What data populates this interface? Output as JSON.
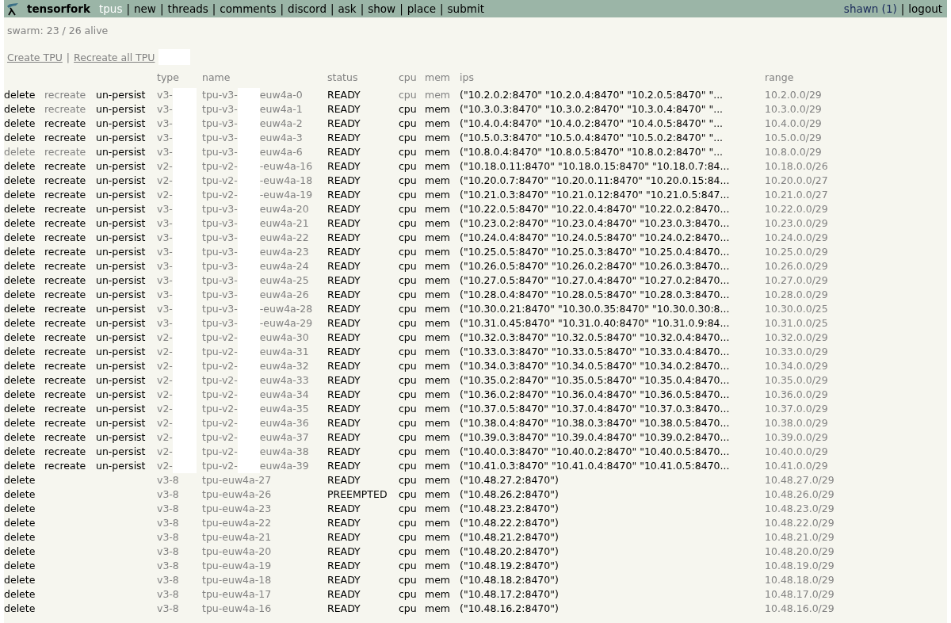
{
  "nav": {
    "brand": "tensorfork",
    "separator": "|",
    "items": [
      {
        "label": "tpus",
        "selected": true
      },
      {
        "label": "new",
        "selected": false
      },
      {
        "label": "threads",
        "selected": false
      },
      {
        "label": "comments",
        "selected": false
      },
      {
        "label": "discord",
        "selected": false
      },
      {
        "label": "ask",
        "selected": false
      },
      {
        "label": "show",
        "selected": false
      },
      {
        "label": "place",
        "selected": false
      },
      {
        "label": "submit",
        "selected": false
      }
    ],
    "user": "shawn (1)",
    "logout": "logout"
  },
  "swarm": "swarm: 23 / 26 alive",
  "links": {
    "separator": "|",
    "items": [
      {
        "label": "Create TPU",
        "redacted": false
      },
      {
        "label": "Recreate all TPU",
        "redacted": true
      }
    ]
  },
  "table": {
    "columns": [
      "type",
      "name",
      "status",
      "cpu",
      "mem",
      "ips",
      "range"
    ],
    "rows": [
      {
        "actions": [
          {
            "label": "delete",
            "disabled": false
          },
          {
            "label": "recreate",
            "disabled": true
          },
          {
            "label": "un-persist",
            "disabled": false
          }
        ],
        "redacted": true,
        "type": "v3-",
        "name": "tpu-v3-",
        "name_tail": "euw4a-0",
        "status": "READY",
        "cpu": {
          "label": "cpu",
          "disabled": true
        },
        "mem": {
          "label": "mem",
          "disabled": true
        },
        "ips": "(\"10.2.0.2:8470\" \"10.2.0.4:8470\" \"10.2.0.5:8470\" \"...",
        "range": "10.2.0.0/29"
      },
      {
        "actions": [
          {
            "label": "delete",
            "disabled": false
          },
          {
            "label": "recreate",
            "disabled": true
          },
          {
            "label": "un-persist",
            "disabled": false
          }
        ],
        "redacted": true,
        "type": "v3-",
        "name": "tpu-v3-",
        "name_tail": "euw4a-1",
        "status": "READY",
        "cpu": {
          "label": "cpu",
          "disabled": false
        },
        "mem": {
          "label": "mem",
          "disabled": false
        },
        "ips": "(\"10.3.0.3:8470\" \"10.3.0.2:8470\" \"10.3.0.4:8470\" \"...",
        "range": "10.3.0.0/29"
      },
      {
        "actions": [
          {
            "label": "delete",
            "disabled": false
          },
          {
            "label": "recreate",
            "disabled": false
          },
          {
            "label": "un-persist",
            "disabled": false
          }
        ],
        "redacted": true,
        "type": "v3-",
        "name": "tpu-v3-",
        "name_tail": "euw4a-2",
        "status": "READY",
        "cpu": {
          "label": "cpu",
          "disabled": false
        },
        "mem": {
          "label": "mem",
          "disabled": false
        },
        "ips": "(\"10.4.0.4:8470\" \"10.4.0.2:8470\" \"10.4.0.5:8470\" \"...",
        "range": "10.4.0.0/29"
      },
      {
        "actions": [
          {
            "label": "delete",
            "disabled": false
          },
          {
            "label": "recreate",
            "disabled": false
          },
          {
            "label": "un-persist",
            "disabled": false
          }
        ],
        "redacted": true,
        "type": "v3-",
        "name": "tpu-v3-",
        "name_tail": "euw4a-3",
        "status": "READY",
        "cpu": {
          "label": "cpu",
          "disabled": false
        },
        "mem": {
          "label": "mem",
          "disabled": false
        },
        "ips": "(\"10.5.0.3:8470\" \"10.5.0.4:8470\" \"10.5.0.2:8470\" \"...",
        "range": "10.5.0.0/29"
      },
      {
        "actions": [
          {
            "label": "delete",
            "disabled": true
          },
          {
            "label": "recreate",
            "disabled": true
          },
          {
            "label": "un-persist",
            "disabled": false
          }
        ],
        "redacted": true,
        "type": "v3-",
        "name": "tpu-v3-",
        "name_tail": "euw4a-6",
        "status": "READY",
        "cpu": {
          "label": "cpu",
          "disabled": false
        },
        "mem": {
          "label": "mem",
          "disabled": false
        },
        "ips": "(\"10.8.0.4:8470\" \"10.8.0.5:8470\" \"10.8.0.2:8470\" \"...",
        "range": "10.8.0.0/29"
      },
      {
        "actions": [
          {
            "label": "delete",
            "disabled": false
          },
          {
            "label": "recreate",
            "disabled": false
          },
          {
            "label": "un-persist",
            "disabled": false
          }
        ],
        "redacted": true,
        "type": "v2-",
        "name": "tpu-v2-",
        "name_tail": "-euw4a-16",
        "status": "READY",
        "cpu": {
          "label": "cpu",
          "disabled": false
        },
        "mem": {
          "label": "mem",
          "disabled": false
        },
        "ips": "(\"10.18.0.11:8470\" \"10.18.0.15:8470\" \"10.18.0.7:84...",
        "range": "10.18.0.0/26"
      },
      {
        "actions": [
          {
            "label": "delete",
            "disabled": false
          },
          {
            "label": "recreate",
            "disabled": false
          },
          {
            "label": "un-persist",
            "disabled": false
          }
        ],
        "redacted": true,
        "type": "v2-",
        "name": "tpu-v2-",
        "name_tail": "-euw4a-18",
        "status": "READY",
        "cpu": {
          "label": "cpu",
          "disabled": false
        },
        "mem": {
          "label": "mem",
          "disabled": false
        },
        "ips": "(\"10.20.0.7:8470\" \"10.20.0.11:8470\" \"10.20.0.15:84...",
        "range": "10.20.0.0/27"
      },
      {
        "actions": [
          {
            "label": "delete",
            "disabled": false
          },
          {
            "label": "recreate",
            "disabled": false
          },
          {
            "label": "un-persist",
            "disabled": false
          }
        ],
        "redacted": true,
        "type": "v2-",
        "name": "tpu-v2-",
        "name_tail": "-euw4a-19",
        "status": "READY",
        "cpu": {
          "label": "cpu",
          "disabled": false
        },
        "mem": {
          "label": "mem",
          "disabled": false
        },
        "ips": "(\"10.21.0.3:8470\" \"10.21.0.12:8470\" \"10.21.0.5:847...",
        "range": "10.21.0.0/27"
      },
      {
        "actions": [
          {
            "label": "delete",
            "disabled": false
          },
          {
            "label": "recreate",
            "disabled": false
          },
          {
            "label": "un-persist",
            "disabled": false
          }
        ],
        "redacted": true,
        "type": "v3-",
        "name": "tpu-v3-",
        "name_tail": "euw4a-20",
        "status": "READY",
        "cpu": {
          "label": "cpu",
          "disabled": false
        },
        "mem": {
          "label": "mem",
          "disabled": false
        },
        "ips": "(\"10.22.0.5:8470\" \"10.22.0.4:8470\" \"10.22.0.2:8470...",
        "range": "10.22.0.0/29"
      },
      {
        "actions": [
          {
            "label": "delete",
            "disabled": false
          },
          {
            "label": "recreate",
            "disabled": false
          },
          {
            "label": "un-persist",
            "disabled": false
          }
        ],
        "redacted": true,
        "type": "v3-",
        "name": "tpu-v3-",
        "name_tail": "euw4a-21",
        "status": "READY",
        "cpu": {
          "label": "cpu",
          "disabled": false
        },
        "mem": {
          "label": "mem",
          "disabled": false
        },
        "ips": "(\"10.23.0.2:8470\" \"10.23.0.4:8470\" \"10.23.0.3:8470...",
        "range": "10.23.0.0/29"
      },
      {
        "actions": [
          {
            "label": "delete",
            "disabled": false
          },
          {
            "label": "recreate",
            "disabled": false
          },
          {
            "label": "un-persist",
            "disabled": false
          }
        ],
        "redacted": true,
        "type": "v3-",
        "name": "tpu-v3-",
        "name_tail": "euw4a-22",
        "status": "READY",
        "cpu": {
          "label": "cpu",
          "disabled": false
        },
        "mem": {
          "label": "mem",
          "disabled": false
        },
        "ips": "(\"10.24.0.4:8470\" \"10.24.0.5:8470\" \"10.24.0.2:8470...",
        "range": "10.24.0.0/29"
      },
      {
        "actions": [
          {
            "label": "delete",
            "disabled": false
          },
          {
            "label": "recreate",
            "disabled": false
          },
          {
            "label": "un-persist",
            "disabled": false
          }
        ],
        "redacted": true,
        "type": "v3-",
        "name": "tpu-v3-",
        "name_tail": "euw4a-23",
        "status": "READY",
        "cpu": {
          "label": "cpu",
          "disabled": false
        },
        "mem": {
          "label": "mem",
          "disabled": false
        },
        "ips": "(\"10.25.0.5:8470\" \"10.25.0.3:8470\" \"10.25.0.4:8470...",
        "range": "10.25.0.0/29"
      },
      {
        "actions": [
          {
            "label": "delete",
            "disabled": false
          },
          {
            "label": "recreate",
            "disabled": false
          },
          {
            "label": "un-persist",
            "disabled": false
          }
        ],
        "redacted": true,
        "type": "v3-",
        "name": "tpu-v3-",
        "name_tail": "euw4a-24",
        "status": "READY",
        "cpu": {
          "label": "cpu",
          "disabled": false
        },
        "mem": {
          "label": "mem",
          "disabled": false
        },
        "ips": "(\"10.26.0.5:8470\" \"10.26.0.2:8470\" \"10.26.0.3:8470...",
        "range": "10.26.0.0/29"
      },
      {
        "actions": [
          {
            "label": "delete",
            "disabled": false
          },
          {
            "label": "recreate",
            "disabled": false
          },
          {
            "label": "un-persist",
            "disabled": false
          }
        ],
        "redacted": true,
        "type": "v3-",
        "name": "tpu-v3-",
        "name_tail": "euw4a-25",
        "status": "READY",
        "cpu": {
          "label": "cpu",
          "disabled": false
        },
        "mem": {
          "label": "mem",
          "disabled": false
        },
        "ips": "(\"10.27.0.5:8470\" \"10.27.0.4:8470\" \"10.27.0.2:8470...",
        "range": "10.27.0.0/29"
      },
      {
        "actions": [
          {
            "label": "delete",
            "disabled": false
          },
          {
            "label": "recreate",
            "disabled": false
          },
          {
            "label": "un-persist",
            "disabled": false
          }
        ],
        "redacted": true,
        "type": "v3-",
        "name": "tpu-v3-",
        "name_tail": "euw4a-26",
        "status": "READY",
        "cpu": {
          "label": "cpu",
          "disabled": false
        },
        "mem": {
          "label": "mem",
          "disabled": false
        },
        "ips": "(\"10.28.0.4:8470\" \"10.28.0.5:8470\" \"10.28.0.3:8470...",
        "range": "10.28.0.0/29"
      },
      {
        "actions": [
          {
            "label": "delete",
            "disabled": false
          },
          {
            "label": "recreate",
            "disabled": false
          },
          {
            "label": "un-persist",
            "disabled": false
          }
        ],
        "redacted": true,
        "type": "v3-",
        "name": "tpu-v3-",
        "name_tail": "-euw4a-28",
        "status": "READY",
        "cpu": {
          "label": "cpu",
          "disabled": false
        },
        "mem": {
          "label": "mem",
          "disabled": false
        },
        "ips": "(\"10.30.0.21:8470\" \"10.30.0.35:8470\" \"10.30.0.30:8...",
        "range": "10.30.0.0/25"
      },
      {
        "actions": [
          {
            "label": "delete",
            "disabled": false
          },
          {
            "label": "recreate",
            "disabled": false
          },
          {
            "label": "un-persist",
            "disabled": false
          }
        ],
        "redacted": true,
        "type": "v3-",
        "name": "tpu-v3-",
        "name_tail": "-euw4a-29",
        "status": "READY",
        "cpu": {
          "label": "cpu",
          "disabled": false
        },
        "mem": {
          "label": "mem",
          "disabled": false
        },
        "ips": "(\"10.31.0.45:8470\" \"10.31.0.40:8470\" \"10.31.0.9:84...",
        "range": "10.31.0.0/25"
      },
      {
        "actions": [
          {
            "label": "delete",
            "disabled": false
          },
          {
            "label": "recreate",
            "disabled": false
          },
          {
            "label": "un-persist",
            "disabled": false
          }
        ],
        "redacted": true,
        "type": "v2-",
        "name": "tpu-v2-",
        "name_tail": "euw4a-30",
        "status": "READY",
        "cpu": {
          "label": "cpu",
          "disabled": false
        },
        "mem": {
          "label": "mem",
          "disabled": false
        },
        "ips": "(\"10.32.0.3:8470\" \"10.32.0.5:8470\" \"10.32.0.4:8470...",
        "range": "10.32.0.0/29"
      },
      {
        "actions": [
          {
            "label": "delete",
            "disabled": false
          },
          {
            "label": "recreate",
            "disabled": false
          },
          {
            "label": "un-persist",
            "disabled": false
          }
        ],
        "redacted": true,
        "type": "v2-",
        "name": "tpu-v2-",
        "name_tail": "euw4a-31",
        "status": "READY",
        "cpu": {
          "label": "cpu",
          "disabled": false
        },
        "mem": {
          "label": "mem",
          "disabled": false
        },
        "ips": "(\"10.33.0.3:8470\" \"10.33.0.5:8470\" \"10.33.0.4:8470...",
        "range": "10.33.0.0/29"
      },
      {
        "actions": [
          {
            "label": "delete",
            "disabled": false
          },
          {
            "label": "recreate",
            "disabled": false
          },
          {
            "label": "un-persist",
            "disabled": false
          }
        ],
        "redacted": true,
        "type": "v2-",
        "name": "tpu-v2-",
        "name_tail": "euw4a-32",
        "status": "READY",
        "cpu": {
          "label": "cpu",
          "disabled": false
        },
        "mem": {
          "label": "mem",
          "disabled": false
        },
        "ips": "(\"10.34.0.3:8470\" \"10.34.0.5:8470\" \"10.34.0.2:8470...",
        "range": "10.34.0.0/29"
      },
      {
        "actions": [
          {
            "label": "delete",
            "disabled": false
          },
          {
            "label": "recreate",
            "disabled": false
          },
          {
            "label": "un-persist",
            "disabled": false
          }
        ],
        "redacted": true,
        "type": "v2-",
        "name": "tpu-v2-",
        "name_tail": "euw4a-33",
        "status": "READY",
        "cpu": {
          "label": "cpu",
          "disabled": false
        },
        "mem": {
          "label": "mem",
          "disabled": false
        },
        "ips": "(\"10.35.0.2:8470\" \"10.35.0.5:8470\" \"10.35.0.4:8470...",
        "range": "10.35.0.0/29"
      },
      {
        "actions": [
          {
            "label": "delete",
            "disabled": false
          },
          {
            "label": "recreate",
            "disabled": false
          },
          {
            "label": "un-persist",
            "disabled": false
          }
        ],
        "redacted": true,
        "type": "v2-",
        "name": "tpu-v2-",
        "name_tail": "euw4a-34",
        "status": "READY",
        "cpu": {
          "label": "cpu",
          "disabled": false
        },
        "mem": {
          "label": "mem",
          "disabled": false
        },
        "ips": "(\"10.36.0.2:8470\" \"10.36.0.4:8470\" \"10.36.0.5:8470...",
        "range": "10.36.0.0/29"
      },
      {
        "actions": [
          {
            "label": "delete",
            "disabled": false
          },
          {
            "label": "recreate",
            "disabled": false
          },
          {
            "label": "un-persist",
            "disabled": false
          }
        ],
        "redacted": true,
        "type": "v2-",
        "name": "tpu-v2-",
        "name_tail": "euw4a-35",
        "status": "READY",
        "cpu": {
          "label": "cpu",
          "disabled": false
        },
        "mem": {
          "label": "mem",
          "disabled": false
        },
        "ips": "(\"10.37.0.5:8470\" \"10.37.0.4:8470\" \"10.37.0.3:8470...",
        "range": "10.37.0.0/29"
      },
      {
        "actions": [
          {
            "label": "delete",
            "disabled": false
          },
          {
            "label": "recreate",
            "disabled": false
          },
          {
            "label": "un-persist",
            "disabled": false
          }
        ],
        "redacted": true,
        "type": "v2-",
        "name": "tpu-v2-",
        "name_tail": "euw4a-36",
        "status": "READY",
        "cpu": {
          "label": "cpu",
          "disabled": false
        },
        "mem": {
          "label": "mem",
          "disabled": false
        },
        "ips": "(\"10.38.0.4:8470\" \"10.38.0.3:8470\" \"10.38.0.5:8470...",
        "range": "10.38.0.0/29"
      },
      {
        "actions": [
          {
            "label": "delete",
            "disabled": false
          },
          {
            "label": "recreate",
            "disabled": false
          },
          {
            "label": "un-persist",
            "disabled": false
          }
        ],
        "redacted": true,
        "type": "v2-",
        "name": "tpu-v2-",
        "name_tail": "euw4a-37",
        "status": "READY",
        "cpu": {
          "label": "cpu",
          "disabled": false
        },
        "mem": {
          "label": "mem",
          "disabled": false
        },
        "ips": "(\"10.39.0.3:8470\" \"10.39.0.4:8470\" \"10.39.0.2:8470...",
        "range": "10.39.0.0/29"
      },
      {
        "actions": [
          {
            "label": "delete",
            "disabled": false
          },
          {
            "label": "recreate",
            "disabled": false
          },
          {
            "label": "un-persist",
            "disabled": false
          }
        ],
        "redacted": true,
        "type": "v2-",
        "name": "tpu-v2-",
        "name_tail": "euw4a-38",
        "status": "READY",
        "cpu": {
          "label": "cpu",
          "disabled": false
        },
        "mem": {
          "label": "mem",
          "disabled": false
        },
        "ips": "(\"10.40.0.3:8470\" \"10.40.0.2:8470\" \"10.40.0.5:8470...",
        "range": "10.40.0.0/29"
      },
      {
        "actions": [
          {
            "label": "delete",
            "disabled": false
          },
          {
            "label": "recreate",
            "disabled": false
          },
          {
            "label": "un-persist",
            "disabled": false
          }
        ],
        "redacted": true,
        "type": "v2-",
        "name": "tpu-v2-",
        "name_tail": "euw4a-39",
        "status": "READY",
        "cpu": {
          "label": "cpu",
          "disabled": false
        },
        "mem": {
          "label": "mem",
          "disabled": false
        },
        "ips": "(\"10.41.0.3:8470\" \"10.41.0.4:8470\" \"10.41.0.5:8470...",
        "range": "10.41.0.0/29"
      },
      {
        "actions": [
          {
            "label": "delete",
            "disabled": false
          }
        ],
        "redacted": false,
        "type": "v3-8",
        "name": "tpu-euw4a-27",
        "status": "READY",
        "cpu": {
          "label": "cpu",
          "disabled": false
        },
        "mem": {
          "label": "mem",
          "disabled": false
        },
        "ips": "(\"10.48.27.2:8470\")",
        "range": "10.48.27.0/29"
      },
      {
        "actions": [
          {
            "label": "delete",
            "disabled": false
          }
        ],
        "redacted": false,
        "type": "v3-8",
        "name": "tpu-euw4a-26",
        "status": "PREEMPTED",
        "cpu": {
          "label": "cpu",
          "disabled": false
        },
        "mem": {
          "label": "mem",
          "disabled": false
        },
        "ips": "(\"10.48.26.2:8470\")",
        "range": "10.48.26.0/29"
      },
      {
        "actions": [
          {
            "label": "delete",
            "disabled": false
          }
        ],
        "redacted": false,
        "type": "v3-8",
        "name": "tpu-euw4a-23",
        "status": "READY",
        "cpu": {
          "label": "cpu",
          "disabled": false
        },
        "mem": {
          "label": "mem",
          "disabled": false
        },
        "ips": "(\"10.48.23.2:8470\")",
        "range": "10.48.23.0/29"
      },
      {
        "actions": [
          {
            "label": "delete",
            "disabled": false
          }
        ],
        "redacted": false,
        "type": "v3-8",
        "name": "tpu-euw4a-22",
        "status": "READY",
        "cpu": {
          "label": "cpu",
          "disabled": false
        },
        "mem": {
          "label": "mem",
          "disabled": false
        },
        "ips": "(\"10.48.22.2:8470\")",
        "range": "10.48.22.0/29"
      },
      {
        "actions": [
          {
            "label": "delete",
            "disabled": false
          }
        ],
        "redacted": false,
        "type": "v3-8",
        "name": "tpu-euw4a-21",
        "status": "READY",
        "cpu": {
          "label": "cpu",
          "disabled": false
        },
        "mem": {
          "label": "mem",
          "disabled": false
        },
        "ips": "(\"10.48.21.2:8470\")",
        "range": "10.48.21.0/29"
      },
      {
        "actions": [
          {
            "label": "delete",
            "disabled": false
          }
        ],
        "redacted": false,
        "type": "v3-8",
        "name": "tpu-euw4a-20",
        "status": "READY",
        "cpu": {
          "label": "cpu",
          "disabled": false
        },
        "mem": {
          "label": "mem",
          "disabled": false
        },
        "ips": "(\"10.48.20.2:8470\")",
        "range": "10.48.20.0/29"
      },
      {
        "actions": [
          {
            "label": "delete",
            "disabled": false
          }
        ],
        "redacted": false,
        "type": "v3-8",
        "name": "tpu-euw4a-19",
        "status": "READY",
        "cpu": {
          "label": "cpu",
          "disabled": false
        },
        "mem": {
          "label": "mem",
          "disabled": false
        },
        "ips": "(\"10.48.19.2:8470\")",
        "range": "10.48.19.0/29"
      },
      {
        "actions": [
          {
            "label": "delete",
            "disabled": false
          }
        ],
        "redacted": false,
        "type": "v3-8",
        "name": "tpu-euw4a-18",
        "status": "READY",
        "cpu": {
          "label": "cpu",
          "disabled": false
        },
        "mem": {
          "label": "mem",
          "disabled": false
        },
        "ips": "(\"10.48.18.2:8470\")",
        "range": "10.48.18.0/29"
      },
      {
        "actions": [
          {
            "label": "delete",
            "disabled": false
          }
        ],
        "redacted": false,
        "type": "v3-8",
        "name": "tpu-euw4a-17",
        "status": "READY",
        "cpu": {
          "label": "cpu",
          "disabled": false
        },
        "mem": {
          "label": "mem",
          "disabled": false
        },
        "ips": "(\"10.48.17.2:8470\")",
        "range": "10.48.17.0/29"
      },
      {
        "actions": [
          {
            "label": "delete",
            "disabled": false
          }
        ],
        "redacted": false,
        "type": "v3-8",
        "name": "tpu-euw4a-16",
        "status": "READY",
        "cpu": {
          "label": "cpu",
          "disabled": false
        },
        "mem": {
          "label": "mem",
          "disabled": false
        },
        "ips": "(\"10.48.16.2:8470\")",
        "range": "10.48.16.0/29"
      }
    ]
  }
}
